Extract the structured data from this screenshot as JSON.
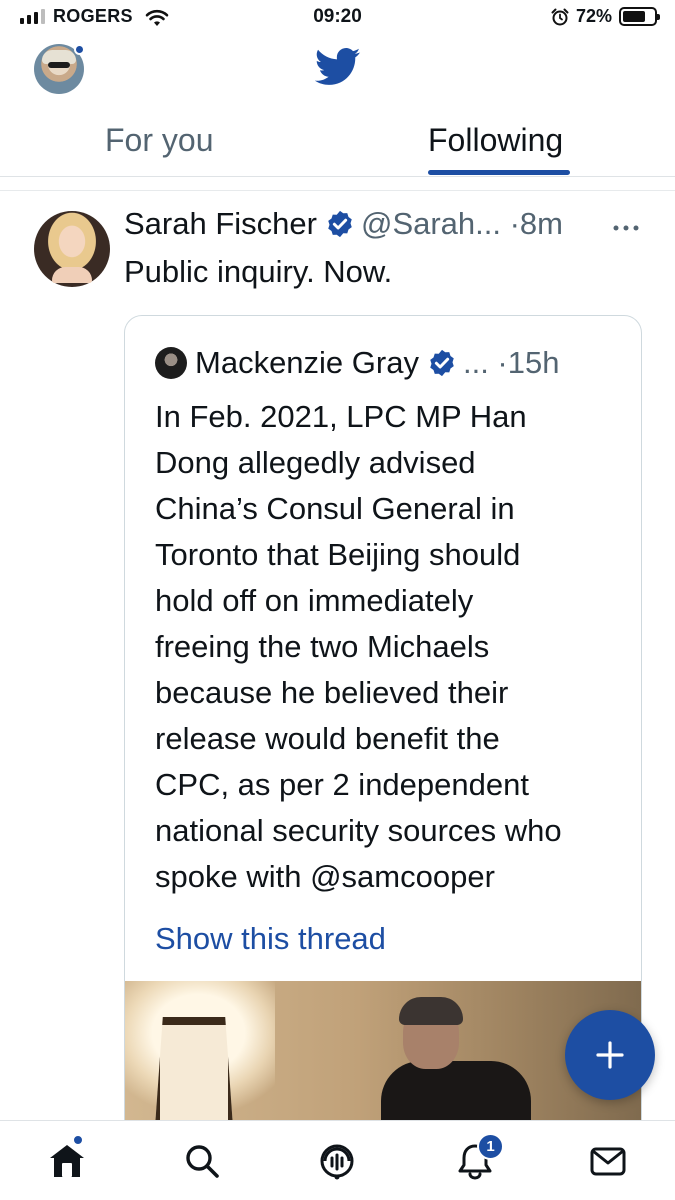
{
  "status_bar": {
    "carrier": "ROGERS",
    "time": "09:20",
    "battery_percent": "72%",
    "battery_level": 0.72,
    "icons": [
      "signal-icon",
      "wifi-icon",
      "alarm-icon",
      "battery-icon"
    ]
  },
  "header": {
    "icons": [
      "profile-avatar",
      "twitter-bird-icon"
    ]
  },
  "tabs": [
    {
      "label": "For you",
      "selected": false
    },
    {
      "label": "Following",
      "selected": true
    }
  ],
  "tweet": {
    "author_name": "Sarah Fischer",
    "handle_time": "@Sarah... ·8m",
    "text": "Public inquiry. Now.",
    "quote": {
      "author_name": "Mackenzie Gray",
      "meta": "... ·15h",
      "text": "In Feb. 2021, LPC MP Han\nDong allegedly advised\nChina’s Consul General in\nToronto that Beijing should\nhold off on immediately\nfreeing the two Michaels\nbecause he believed their\nrelease would benefit the\nCPC, as per 2 independent\nnational security sources who\nspoke with @samcooper",
      "show_thread": "Show this thread"
    }
  },
  "fab": {
    "icon": "compose-plus-icon"
  },
  "bottom_nav": {
    "items": [
      "home-icon",
      "search-icon",
      "spaces-icon",
      "notifications-icon",
      "messages-icon"
    ],
    "notification_count": "1"
  },
  "colors": {
    "accent": "#1d4ea3",
    "text_primary": "#0f1419",
    "text_secondary": "#536471",
    "border": "#cfd9de"
  }
}
